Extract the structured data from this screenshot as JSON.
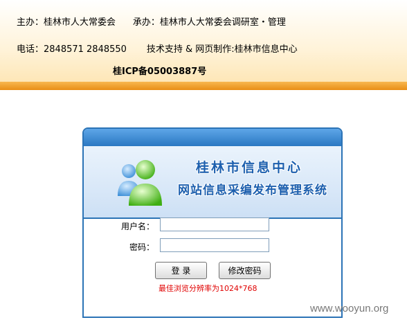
{
  "header": {
    "sponsor": "主办：桂林市人大常委会",
    "organizer": "承办：桂林市人大常委会调研室・管理",
    "phone": "电话：2848571 2848550",
    "support": "技术支持 & 网页制作:桂林市信息中心",
    "icp": "桂ICP备05003887号"
  },
  "login": {
    "title": "桂林市信息中心",
    "subtitle": "网站信息采编发布管理系统",
    "username_label": "用户名：",
    "username_value": "",
    "password_label": "密码：",
    "password_value": "",
    "login_button": "登 录",
    "change_password_button": "修改密码",
    "resolution_tip": "最佳浏览分辨率为1024*768"
  },
  "watermark": "www.wooyun.org",
  "colors": {
    "accent_blue": "#2b73b6",
    "header_orange": "#e98e16",
    "tip_red": "#e00000"
  },
  "icons": [
    "users-icon"
  ]
}
